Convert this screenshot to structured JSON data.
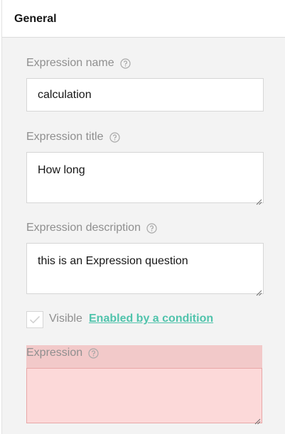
{
  "panel": {
    "title": "General"
  },
  "fields": {
    "name": {
      "label": "Expression name",
      "value": "calculation"
    },
    "title": {
      "label": "Expression title",
      "value": "How long"
    },
    "description": {
      "label": "Expression description",
      "value": "this is an Expression question"
    },
    "visible": {
      "label": "Visible",
      "checked": true,
      "condition_link": "Enabled by a condition"
    },
    "expression": {
      "label": "Expression",
      "value": "",
      "error_color": "#fcd9d9"
    }
  },
  "colors": {
    "accent": "#19b394",
    "label": "#8f8f8f",
    "background": "#f3f3f3"
  },
  "icons": {
    "help": "question-circle-icon",
    "check": "checkmark-icon",
    "resize": "resize-grip-icon"
  }
}
